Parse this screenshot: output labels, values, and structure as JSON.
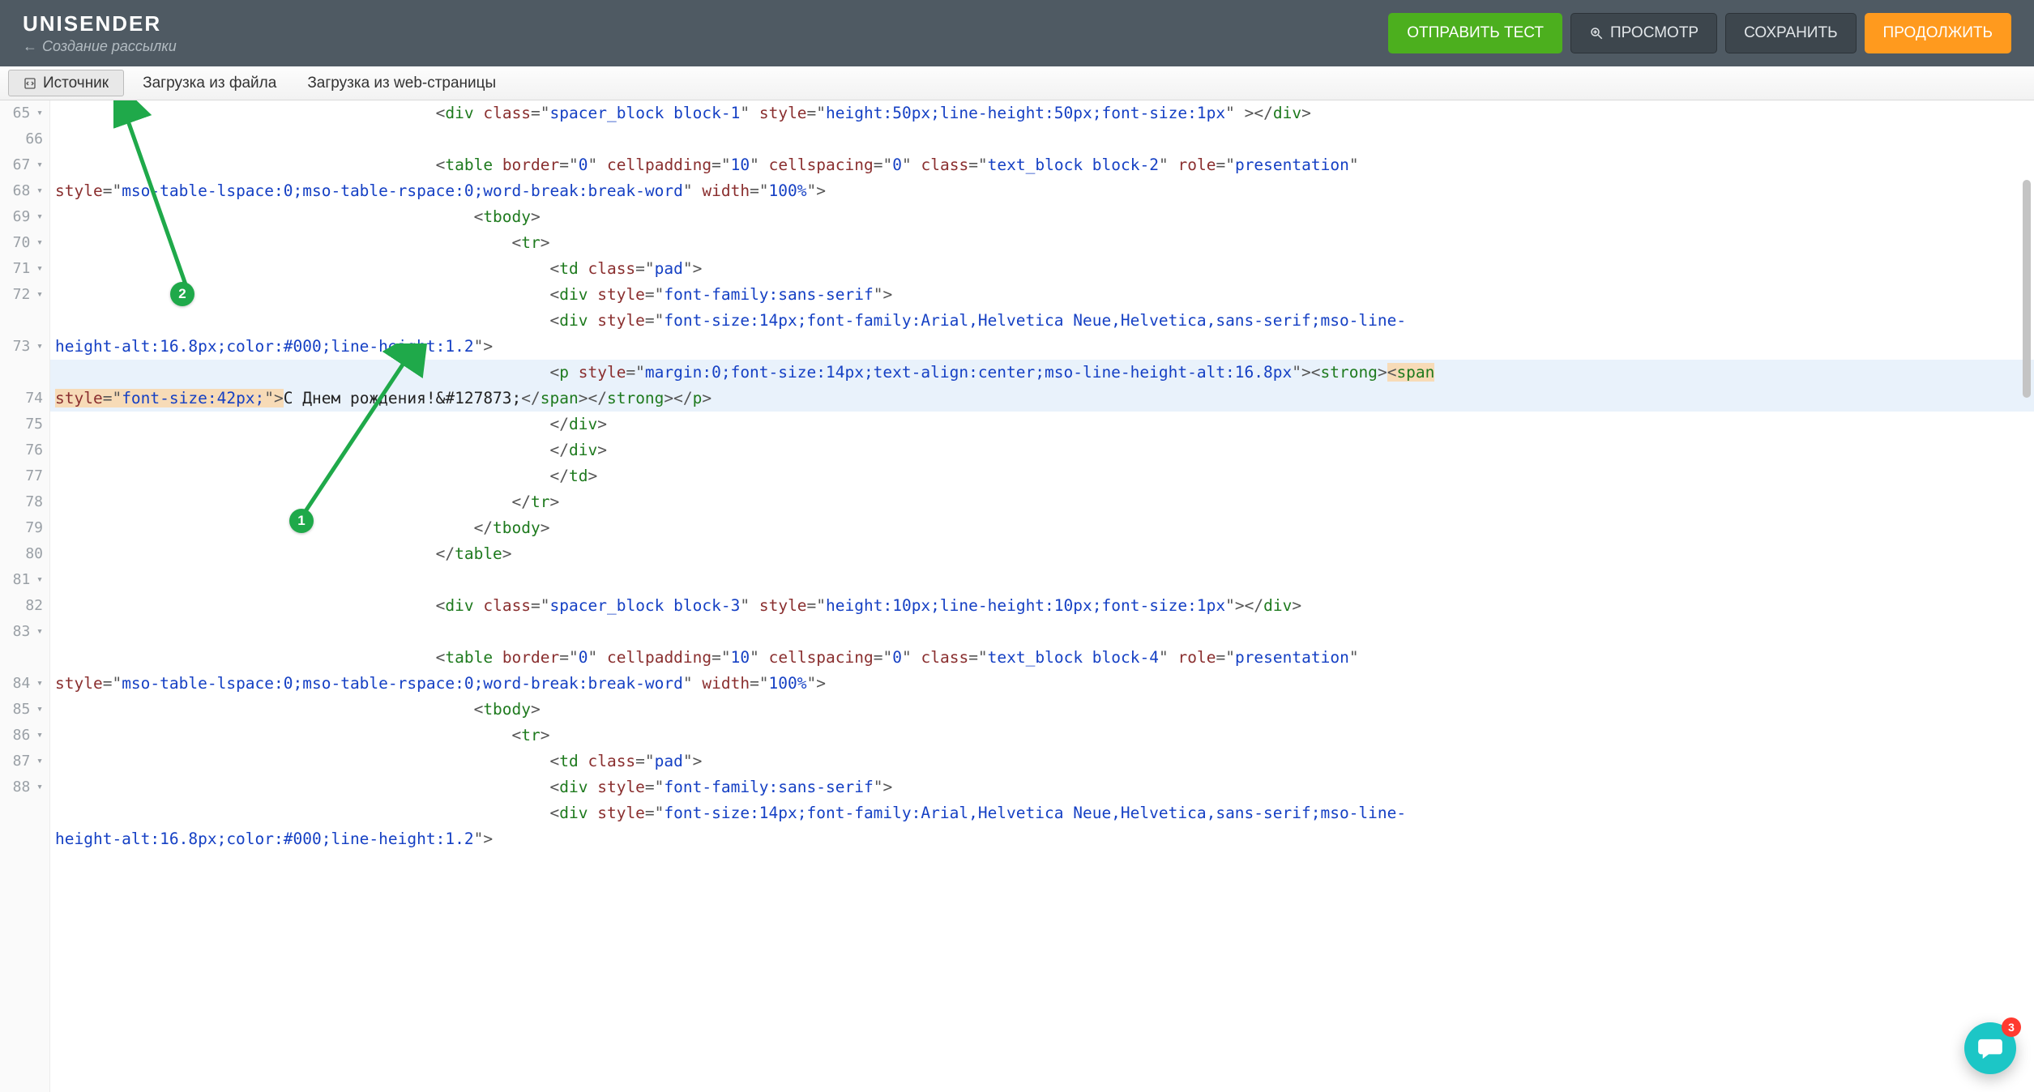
{
  "header": {
    "logo": "UNISENDER",
    "breadcrumb_arrow": "←",
    "breadcrumb_text": "Создание рассылки",
    "buttons": {
      "send_test": "ОТПРАВИТЬ ТЕСТ",
      "preview": "ПРОСМОТР",
      "save": "СОХРАНИТЬ",
      "continue": "ПРОДОЛЖИТЬ"
    }
  },
  "tabs": {
    "source": "Источник",
    "file": "Загрузка из файла",
    "web": "Загрузка из web-страницы"
  },
  "annotations": {
    "one": "1",
    "two": "2"
  },
  "chat": {
    "badge": "3"
  },
  "gutter": {
    "visible_start": 65,
    "lines": [
      {
        "n": "65",
        "fold": true
      },
      {
        "n": "66",
        "fold": false
      },
      {
        "n": "67",
        "fold": true
      },
      {
        "n": "68",
        "fold": true
      },
      {
        "n": "69",
        "fold": true
      },
      {
        "n": "70",
        "fold": true
      },
      {
        "n": "71",
        "fold": true
      },
      {
        "n": "72",
        "fold": true
      },
      {
        "n": "",
        "fold": false
      },
      {
        "n": "73",
        "fold": true
      },
      {
        "n": "",
        "fold": false
      },
      {
        "n": "74",
        "fold": false
      },
      {
        "n": "75",
        "fold": false
      },
      {
        "n": "76",
        "fold": false
      },
      {
        "n": "77",
        "fold": false
      },
      {
        "n": "78",
        "fold": false
      },
      {
        "n": "79",
        "fold": false
      },
      {
        "n": "80",
        "fold": false
      },
      {
        "n": "81",
        "fold": true
      },
      {
        "n": "82",
        "fold": false
      },
      {
        "n": "83",
        "fold": true
      },
      {
        "n": "",
        "fold": false
      },
      {
        "n": "84",
        "fold": true
      },
      {
        "n": "85",
        "fold": true
      },
      {
        "n": "86",
        "fold": true
      },
      {
        "n": "87",
        "fold": true
      },
      {
        "n": "88",
        "fold": true
      },
      {
        "n": "",
        "fold": false
      }
    ]
  },
  "code": {
    "lines": [
      {
        "indent": 40,
        "html": "<span class='t-punct'>&lt;</span><span class='t-tag'>div</span> <span class='t-attr'>class</span><span class='t-punct'>=\"</span><span class='t-val'>spacer_block block-1</span><span class='t-punct'>\"</span> <span class='t-attr'>style</span><span class='t-punct'>=\"</span><span class='t-val'>height:50px;line-height:50px;font-size:1px</span><span class='t-punct'>\"</span> <span class='t-punct'>&gt;&lt;/</span><span class='t-tag'>div</span><span class='t-punct'>&gt;</span>"
      },
      {
        "indent": 0,
        "html": ""
      },
      {
        "indent": 40,
        "html": "<span class='t-punct'>&lt;</span><span class='t-tag'>table</span> <span class='t-attr'>border</span><span class='t-punct'>=\"</span><span class='t-val'>0</span><span class='t-punct'>\"</span> <span class='t-attr'>cellpadding</span><span class='t-punct'>=\"</span><span class='t-val'>10</span><span class='t-punct'>\"</span> <span class='t-attr'>cellspacing</span><span class='t-punct'>=\"</span><span class='t-val'>0</span><span class='t-punct'>\"</span> <span class='t-attr'>class</span><span class='t-punct'>=\"</span><span class='t-val'>text_block block-2</span><span class='t-punct'>\"</span> <span class='t-attr'>role</span><span class='t-punct'>=\"</span><span class='t-val'>presentation</span><span class='t-punct'>\"</span>",
        "wrap": true
      },
      {
        "indent": 0,
        "html": "<span class='t-attr'>style</span><span class='t-punct'>=\"</span><span class='t-val'>mso-table-lspace:0;mso-table-rspace:0;word-break:break-word</span><span class='t-punct'>\"</span> <span class='t-attr'>width</span><span class='t-punct'>=\"</span><span class='t-val'>100%</span><span class='t-punct'>\"</span><span class='t-punct'>&gt;</span>"
      },
      {
        "indent": 44,
        "html": "<span class='t-punct'>&lt;</span><span class='t-tag'>tbody</span><span class='t-punct'>&gt;</span>"
      },
      {
        "indent": 48,
        "html": "<span class='t-punct'>&lt;</span><span class='t-tag'>tr</span><span class='t-punct'>&gt;</span>"
      },
      {
        "indent": 52,
        "html": "<span class='t-punct'>&lt;</span><span class='t-tag'>td</span> <span class='t-attr'>class</span><span class='t-punct'>=\"</span><span class='t-val'>pad</span><span class='t-punct'>\"</span><span class='t-punct'>&gt;</span>"
      },
      {
        "indent": 52,
        "html": "<span class='t-punct'>&lt;</span><span class='t-tag'>div</span> <span class='t-attr'>style</span><span class='t-punct'>=\"</span><span class='t-val'>font-family:sans-serif</span><span class='t-punct'>\"</span><span class='t-punct'>&gt;</span>"
      },
      {
        "indent": 52,
        "html": "<span class='t-punct'>&lt;</span><span class='t-tag'>div</span> <span class='t-attr'>style</span><span class='t-punct'>=\"</span><span class='t-val'>font-size:14px;font-family:Arial,Helvetica Neue,Helvetica,sans-serif;mso-line-</span>",
        "wrap": true
      },
      {
        "indent": 0,
        "html": "<span class='t-val'>height-alt:16.8px;color:#000;line-height:1.2</span><span class='t-punct'>\"</span><span class='t-punct'>&gt;</span>"
      },
      {
        "indent": 52,
        "hl": true,
        "html": "<span class='t-punct'>&lt;</span><span class='t-tag'>p</span> <span class='t-attr'>style</span><span class='t-punct'>=\"</span><span class='t-val'>margin:0;font-size:14px;text-align:center;mso-line-height-alt:16.8px</span><span class='t-punct'>\"&gt;</span><span class='t-punct'>&lt;</span><span class='t-tag'>strong</span><span class='t-punct'>&gt;</span><span class='hl-inline'><span class='t-punct'>&lt;</span><span class='t-tag'>span</span></span>",
        "wrap": true
      },
      {
        "indent": 0,
        "hl": true,
        "html": "<span class='hl-inline'><span class='t-attr'>style</span><span class='t-punct'>=\"</span><span class='t-val'>font-size:42px;</span><span class='t-punct'>\"&gt;</span></span><span class='t-text'>С Днем рождения!&amp;#127873;</span><span class='t-punct'>&lt;/</span><span class='t-tag'>span</span><span class='t-punct'>&gt;&lt;/</span><span class='t-tag'>strong</span><span class='t-punct'>&gt;&lt;/</span><span class='t-tag'>p</span><span class='t-punct'>&gt;</span>"
      },
      {
        "indent": 52,
        "html": "<span class='t-punct'>&lt;/</span><span class='t-tag'>div</span><span class='t-punct'>&gt;</span>"
      },
      {
        "indent": 52,
        "html": "<span class='t-punct'>&lt;/</span><span class='t-tag'>div</span><span class='t-punct'>&gt;</span>"
      },
      {
        "indent": 52,
        "html": "<span class='t-punct'>&lt;/</span><span class='t-tag'>td</span><span class='t-punct'>&gt;</span>"
      },
      {
        "indent": 48,
        "html": "<span class='t-punct'>&lt;/</span><span class='t-tag'>tr</span><span class='t-punct'>&gt;</span>"
      },
      {
        "indent": 44,
        "html": "<span class='t-punct'>&lt;/</span><span class='t-tag'>tbody</span><span class='t-punct'>&gt;</span>"
      },
      {
        "indent": 40,
        "html": "<span class='t-punct'>&lt;/</span><span class='t-tag'>table</span><span class='t-punct'>&gt;</span>"
      },
      {
        "indent": 0,
        "html": ""
      },
      {
        "indent": 40,
        "html": "<span class='t-punct'>&lt;</span><span class='t-tag'>div</span> <span class='t-attr'>class</span><span class='t-punct'>=\"</span><span class='t-val'>spacer_block block-3</span><span class='t-punct'>\"</span> <span class='t-attr'>style</span><span class='t-punct'>=\"</span><span class='t-val'>height:10px;line-height:10px;font-size:1px</span><span class='t-punct'>\"</span><span class='t-punct'>&gt;&lt;/</span><span class='t-tag'>div</span><span class='t-punct'>&gt;</span>"
      },
      {
        "indent": 0,
        "html": ""
      },
      {
        "indent": 40,
        "html": "<span class='t-punct'>&lt;</span><span class='t-tag'>table</span> <span class='t-attr'>border</span><span class='t-punct'>=\"</span><span class='t-val'>0</span><span class='t-punct'>\"</span> <span class='t-attr'>cellpadding</span><span class='t-punct'>=\"</span><span class='t-val'>10</span><span class='t-punct'>\"</span> <span class='t-attr'>cellspacing</span><span class='t-punct'>=\"</span><span class='t-val'>0</span><span class='t-punct'>\"</span> <span class='t-attr'>class</span><span class='t-punct'>=\"</span><span class='t-val'>text_block block-4</span><span class='t-punct'>\"</span> <span class='t-attr'>role</span><span class='t-punct'>=\"</span><span class='t-val'>presentation</span><span class='t-punct'>\"</span>",
        "wrap": true
      },
      {
        "indent": 0,
        "html": "<span class='t-attr'>style</span><span class='t-punct'>=\"</span><span class='t-val'>mso-table-lspace:0;mso-table-rspace:0;word-break:break-word</span><span class='t-punct'>\"</span> <span class='t-attr'>width</span><span class='t-punct'>=\"</span><span class='t-val'>100%</span><span class='t-punct'>\"</span><span class='t-punct'>&gt;</span>"
      },
      {
        "indent": 44,
        "html": "<span class='t-punct'>&lt;</span><span class='t-tag'>tbody</span><span class='t-punct'>&gt;</span>"
      },
      {
        "indent": 48,
        "html": "<span class='t-punct'>&lt;</span><span class='t-tag'>tr</span><span class='t-punct'>&gt;</span>"
      },
      {
        "indent": 52,
        "html": "<span class='t-punct'>&lt;</span><span class='t-tag'>td</span> <span class='t-attr'>class</span><span class='t-punct'>=\"</span><span class='t-val'>pad</span><span class='t-punct'>\"</span><span class='t-punct'>&gt;</span>"
      },
      {
        "indent": 52,
        "html": "<span class='t-punct'>&lt;</span><span class='t-tag'>div</span> <span class='t-attr'>style</span><span class='t-punct'>=\"</span><span class='t-val'>font-family:sans-serif</span><span class='t-punct'>\"</span><span class='t-punct'>&gt;</span>"
      },
      {
        "indent": 52,
        "html": "<span class='t-punct'>&lt;</span><span class='t-tag'>div</span> <span class='t-attr'>style</span><span class='t-punct'>=\"</span><span class='t-val'>font-size:14px;font-family:Arial,Helvetica Neue,Helvetica,sans-serif;mso-line-</span>",
        "wrap": true
      },
      {
        "indent": 0,
        "html": "<span class='t-val'>height-alt:16.8px;color:#000;line-height:1.2</span><span class='t-punct'>\"</span><span class='t-punct'>&gt;</span>"
      }
    ]
  }
}
